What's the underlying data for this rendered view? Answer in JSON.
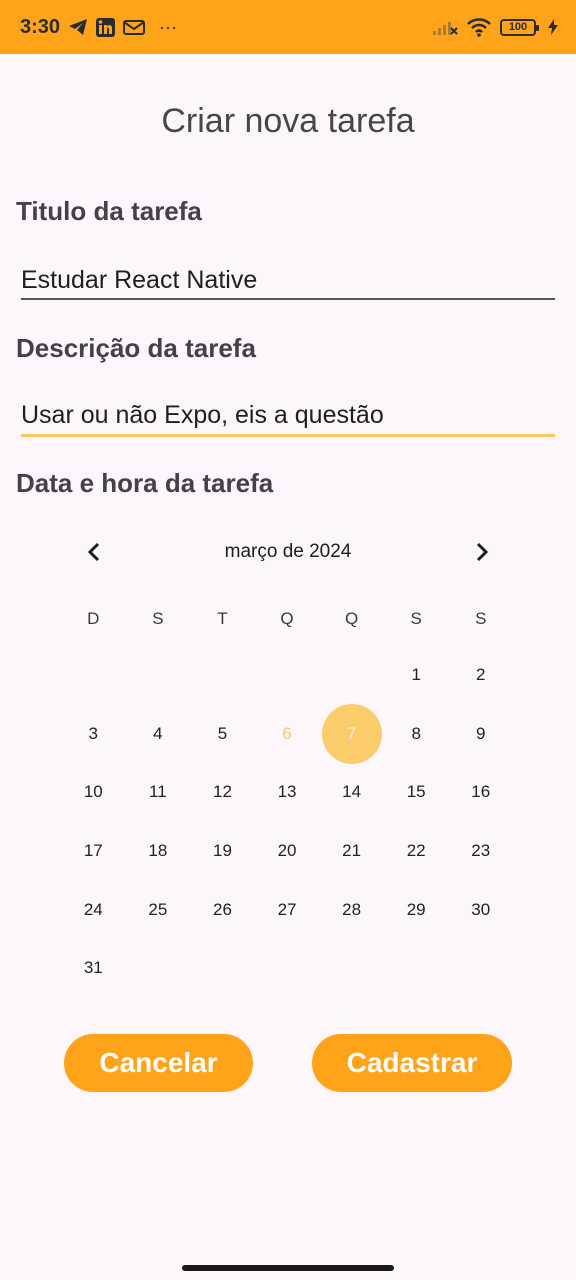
{
  "status_bar": {
    "time": "3:30",
    "battery": "100",
    "more": "···",
    "accent": "#ffa31a"
  },
  "form": {
    "title": "Criar nova tarefa",
    "task_title_label": "Titulo da tarefa",
    "task_title_value": "Estudar React Native",
    "description_label": "Descrição da tarefa",
    "description_value": "Usar ou não Expo, eis a questão",
    "datetime_label": "Data e hora da tarefa"
  },
  "calendar": {
    "month_label": "março de 2024",
    "weekdays": [
      "D",
      "S",
      "T",
      "Q",
      "Q",
      "S",
      "S"
    ],
    "weeks": [
      [
        "",
        "",
        "",
        "",
        "",
        "1",
        "2"
      ],
      [
        "3",
        "4",
        "5",
        "6",
        "7",
        "8",
        "9"
      ],
      [
        "10",
        "11",
        "12",
        "13",
        "14",
        "15",
        "16"
      ],
      [
        "17",
        "18",
        "19",
        "20",
        "21",
        "22",
        "23"
      ],
      [
        "24",
        "25",
        "26",
        "27",
        "28",
        "29",
        "30"
      ],
      [
        "31",
        "",
        "",
        "",
        "",
        "",
        ""
      ]
    ],
    "today": "6",
    "selected": "7"
  },
  "actions": {
    "cancel_label": "Cancelar",
    "submit_label": "Cadastrar"
  }
}
